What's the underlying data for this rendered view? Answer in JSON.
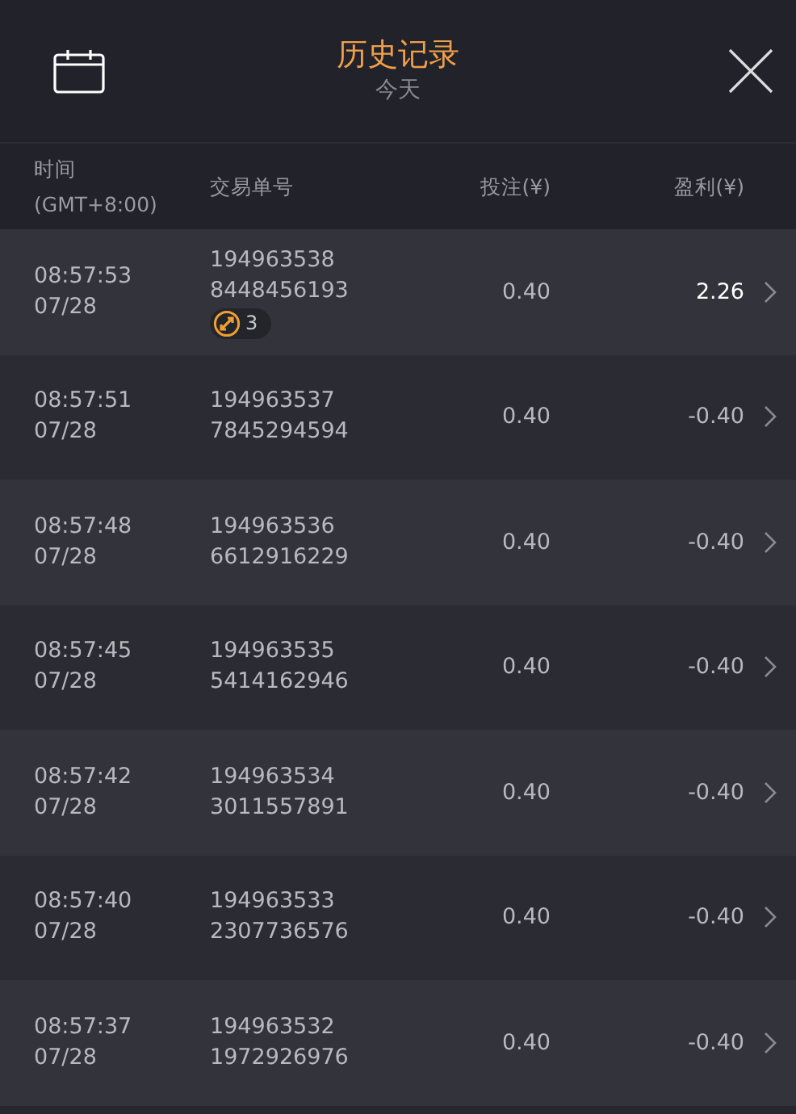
{
  "header": {
    "title": "历史记录",
    "subtitle": "今天"
  },
  "columns": [
    {
      "label": "时间",
      "sublabel": "(GMT+8:00)"
    },
    {
      "label": "交易单号"
    },
    {
      "label": "投注(¥)"
    },
    {
      "label": "盈利(¥)"
    }
  ],
  "rows": [
    {
      "time": "08:57:53",
      "date": "07/28",
      "id": "194963538",
      "ref": "8448456193",
      "badge": "3",
      "stake": "0.40",
      "profit": "2.26",
      "won": true
    },
    {
      "time": "08:57:51",
      "date": "07/28",
      "id": "194963537",
      "ref": "7845294594",
      "stake": "0.40",
      "profit": "-0.40",
      "won": false
    },
    {
      "time": "08:57:48",
      "date": "07/28",
      "id": "194963536",
      "ref": "6612916229",
      "stake": "0.40",
      "profit": "-0.40",
      "won": false
    },
    {
      "time": "08:57:45",
      "date": "07/28",
      "id": "194963535",
      "ref": "5414162946",
      "stake": "0.40",
      "profit": "-0.40",
      "won": false
    },
    {
      "time": "08:57:42",
      "date": "07/28",
      "id": "194963534",
      "ref": "3011557891",
      "stake": "0.40",
      "profit": "-0.40",
      "won": false
    },
    {
      "time": "08:57:40",
      "date": "07/28",
      "id": "194963533",
      "ref": "2307736576",
      "stake": "0.40",
      "profit": "-0.40",
      "won": false
    },
    {
      "time": "08:57:37",
      "date": "07/28",
      "id": "194963532",
      "ref": "1972926976",
      "stake": "0.40",
      "profit": "-0.40",
      "won": false
    }
  ]
}
